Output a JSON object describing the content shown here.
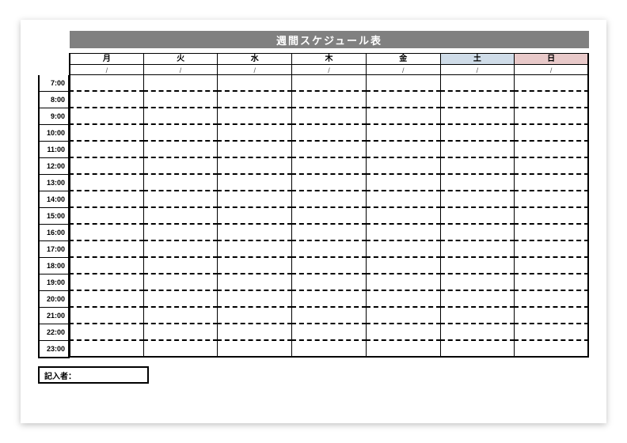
{
  "title": "週間スケジュール表",
  "days": {
    "mon": "月",
    "tue": "火",
    "wed": "水",
    "thu": "木",
    "fri": "金",
    "sat": "土",
    "sun": "日"
  },
  "date_placeholder": "/",
  "dates": {
    "mon": "/",
    "tue": "/",
    "wed": "/",
    "thu": "/",
    "fri": "/",
    "sat": "/",
    "sun": "/"
  },
  "times": [
    "7:00",
    "8:00",
    "9:00",
    "10:00",
    "11:00",
    "12:00",
    "13:00",
    "14:00",
    "15:00",
    "16:00",
    "17:00",
    "18:00",
    "19:00",
    "20:00",
    "21:00",
    "22:00",
    "23:00"
  ],
  "recorder_label": "記入者：",
  "colors": {
    "title_bg": "#808080",
    "sat_bg": "#cfdce8",
    "sun_bg": "#e8c9c9"
  },
  "chart_data": {
    "type": "table",
    "title": "週間スケジュール表",
    "columns": [
      "月",
      "火",
      "水",
      "木",
      "金",
      "土",
      "日"
    ],
    "row_labels": [
      "7:00",
      "8:00",
      "9:00",
      "10:00",
      "11:00",
      "12:00",
      "13:00",
      "14:00",
      "15:00",
      "16:00",
      "17:00",
      "18:00",
      "19:00",
      "20:00",
      "21:00",
      "22:00",
      "23:00"
    ],
    "date_row": [
      "/",
      "/",
      "/",
      "/",
      "/",
      "/",
      "/"
    ],
    "cells": "empty"
  }
}
